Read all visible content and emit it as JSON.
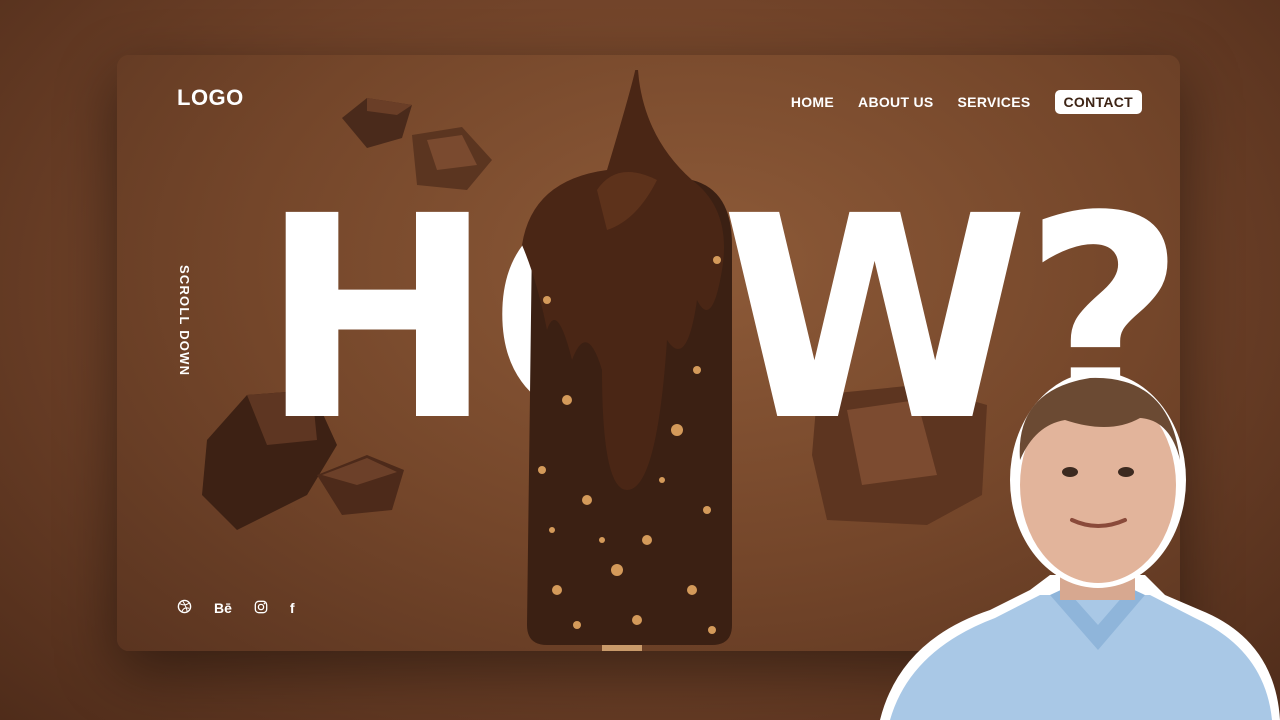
{
  "site": {
    "logo": "LOGO",
    "nav": [
      "HOME",
      "ABOUT US",
      "SERVICES",
      "CONTACT"
    ],
    "headline": "HOW?",
    "scroll_label": "SCROLL DOWN",
    "socials": [
      {
        "icon": "dribbble-icon"
      },
      {
        "icon": "behance-icon",
        "label": "Bē"
      },
      {
        "icon": "instagram-icon"
      },
      {
        "icon": "facebook-icon",
        "label": "f"
      }
    ]
  },
  "colors": {
    "background": "#6e4128",
    "chocolate": "#3a1f12",
    "text": "#ffffff"
  }
}
